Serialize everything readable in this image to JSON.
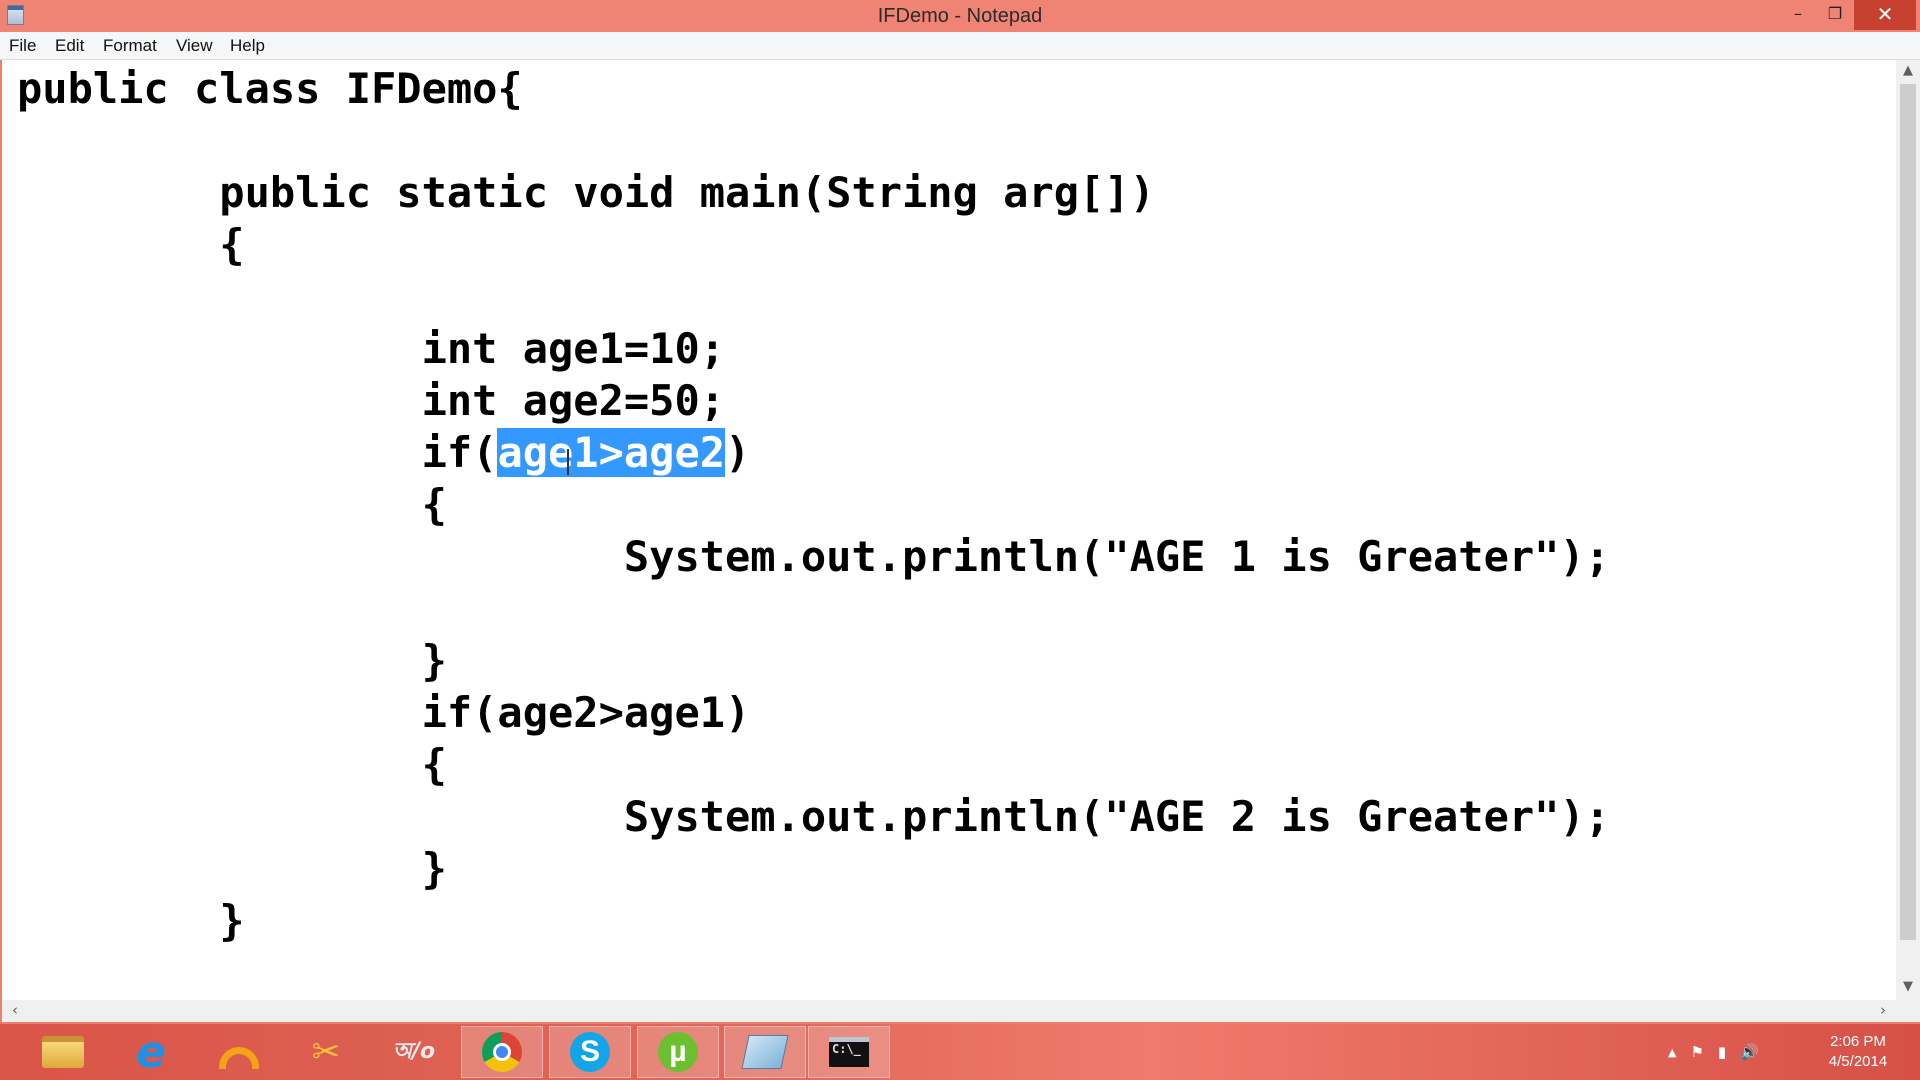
{
  "window": {
    "title": "IFDemo - Notepad",
    "controls": {
      "minimize": "–",
      "maximize": "❐",
      "close": "✕"
    }
  },
  "menu": {
    "file": "File",
    "edit": "Edit",
    "format": "Format",
    "view": "View",
    "help": "Help"
  },
  "editor": {
    "lines": [
      "public class IFDemo{",
      "",
      "        public static void main(String arg[])",
      "        {",
      "",
      "                int age1=10;",
      "                int age2=50;",
      "",
      "                {",
      "                        System.out.println(\"AGE 1 is Greater\");",
      "",
      "                }",
      "                if(age2>age1)",
      "                {",
      "                        System.out.println(\"AGE 2 is Greater\");",
      "                }",
      "        }"
    ],
    "selected_line": {
      "indent": "                ",
      "before": "if(",
      "selected": "age1>age2",
      "after": ")"
    }
  },
  "scrollbars": {
    "up": "▲",
    "down": "▼",
    "left": "‹",
    "right": "›"
  },
  "taskbar": {
    "apps": [
      {
        "icon": "file-explorer-icon"
      },
      {
        "icon": "internet-explorer-icon",
        "glyph": "e"
      },
      {
        "icon": "arc-app-icon"
      },
      {
        "icon": "tools-app-icon",
        "glyph": "✂"
      },
      {
        "icon": "avro-keyboard-icon",
        "glyph": "অ/o"
      },
      {
        "icon": "chrome-icon"
      },
      {
        "icon": "skype-icon",
        "glyph": "S"
      },
      {
        "icon": "utorrent-icon",
        "glyph": "µ"
      },
      {
        "icon": "notepad-icon"
      },
      {
        "icon": "command-prompt-icon",
        "glyph": "C:\\_"
      }
    ],
    "tray": {
      "show_hidden": "▲",
      "action_center": "⚑",
      "network": "▮",
      "volume": "🔊"
    },
    "clock": {
      "time": "2:06 PM",
      "date": "4/5/2014"
    }
  }
}
